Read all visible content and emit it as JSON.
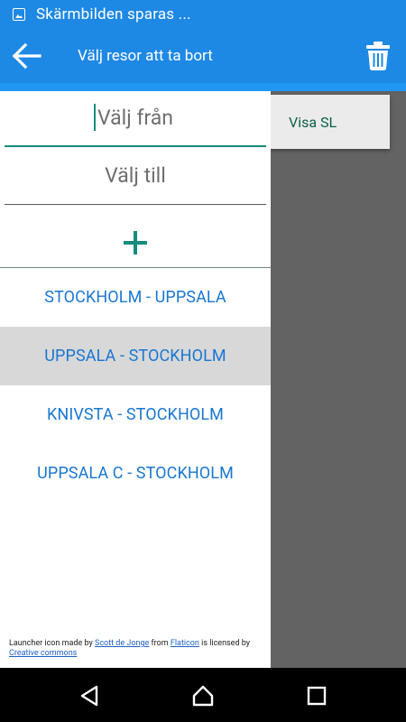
{
  "status_bar": {
    "text": "Skärmbilden sparas ...",
    "icon": "image-icon"
  },
  "toolbar": {
    "title": "Välj resor att ta bort",
    "back_icon": "arrow-left-icon",
    "delete_icon": "trash-icon"
  },
  "menu": {
    "visa_sl": "Visa SL"
  },
  "drawer": {
    "from_placeholder": "Välj från",
    "to_placeholder": "Välj till",
    "add_icon": "plus-icon",
    "routes": [
      {
        "label": "STOCKHOLM - UPPSALA",
        "selected": false
      },
      {
        "label": "UPPSALA - STOCKHOLM",
        "selected": true
      },
      {
        "label": "KNIVSTA - STOCKHOLM",
        "selected": false
      },
      {
        "label": "UPPSALA C - STOCKHOLM",
        "selected": false
      }
    ],
    "credits": {
      "prefix": "Launcher icon made by ",
      "author": "Scott de Jonge",
      "from": " from ",
      "site": "Flaticon",
      "is": " is licensed by ",
      "license": "Creative commons"
    }
  },
  "nav_bar": {
    "back": "back-triangle-icon",
    "home": "home-icon",
    "recents": "recents-square-icon"
  },
  "colors": {
    "primary": "#1e88e5",
    "accent": "#148c7e",
    "route_text": "#1976d2",
    "dim": "#636363"
  }
}
